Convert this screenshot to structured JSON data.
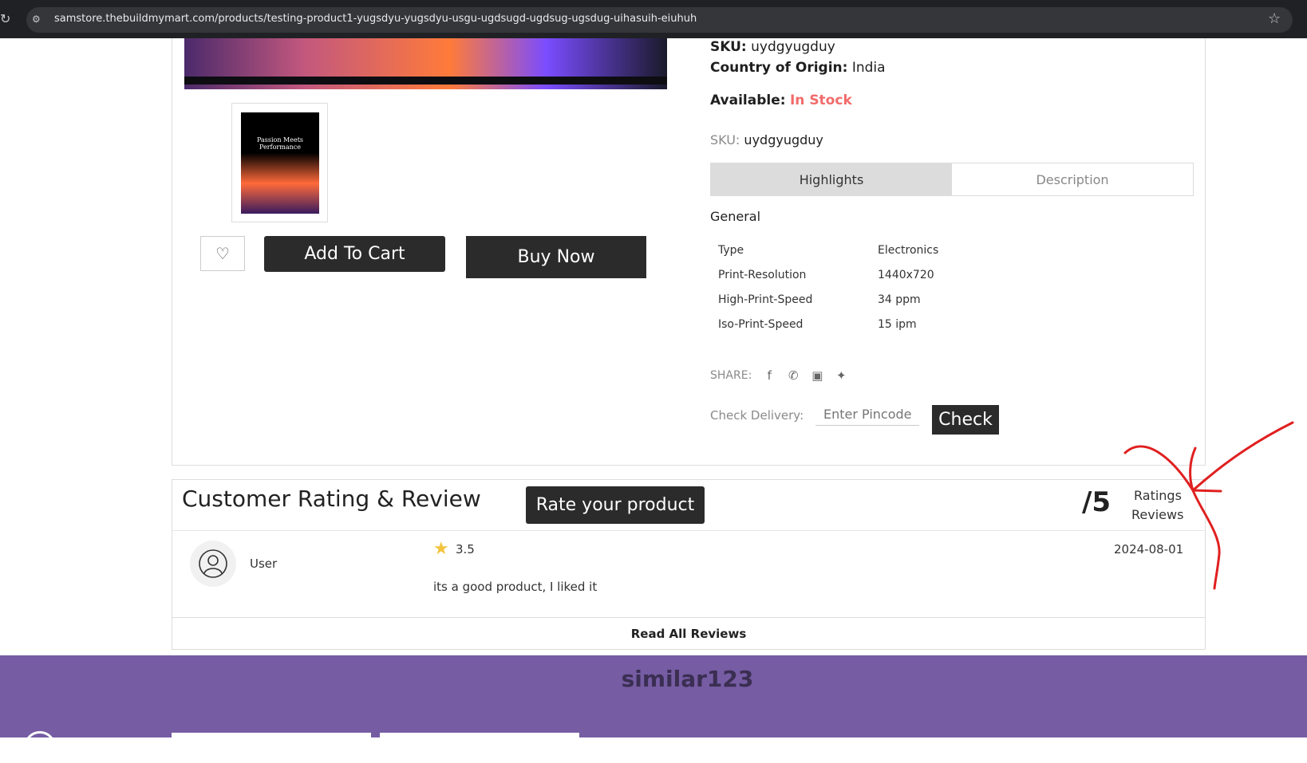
{
  "browser": {
    "url": "samstore.thebuildmymart.com/products/testing-product1-yugsdyu-yugsdyu-usgu-ugdsugd-ugdsug-ugsdug-uihasuih-eiuhuh"
  },
  "product": {
    "thumb_caption": "Passion Meets Performance",
    "add_to_cart": "Add To Cart",
    "buy_now": "Buy Now",
    "sku_label": "SKU:",
    "sku_value": "uydgyugduy",
    "origin_label": "Country of Origin:",
    "origin_value": "India",
    "available_label": "Available:",
    "available_value": "In Stock",
    "sku2_label": "SKU:",
    "sku2_value": "uydgyugduy",
    "tabs": [
      {
        "label": "Highlights"
      },
      {
        "label": "Description"
      }
    ],
    "general_title": "General",
    "specs": [
      {
        "key": "Type",
        "value": "Electronics"
      },
      {
        "key": "Print-Resolution",
        "value": "1440x720"
      },
      {
        "key": "High-Print-Speed",
        "value": "34 ppm"
      },
      {
        "key": "Iso-Print-Speed",
        "value": "15 ipm"
      }
    ],
    "share_label": "SHARE:",
    "delivery_label": "Check Delivery:",
    "pincode_placeholder": "Enter Pincode",
    "check_button": "Check"
  },
  "reviews": {
    "title": "Customer Rating & Review",
    "rate_button": "Rate your product",
    "score": "/5",
    "ratings_label": "Ratings",
    "reviews_label": "Reviews",
    "items": [
      {
        "user": "User",
        "rating": "3.5",
        "date": "2024-08-01",
        "text": "its a good product, I liked it"
      }
    ],
    "read_all": "Read All Reviews"
  },
  "similar": {
    "title": "similar123"
  },
  "colors": {
    "accent_dark": "#2b2b2b",
    "in_stock": "#f26b6b",
    "footer_band": "#765ca3",
    "star": "#f2c43d",
    "annotation": "#e02020"
  }
}
